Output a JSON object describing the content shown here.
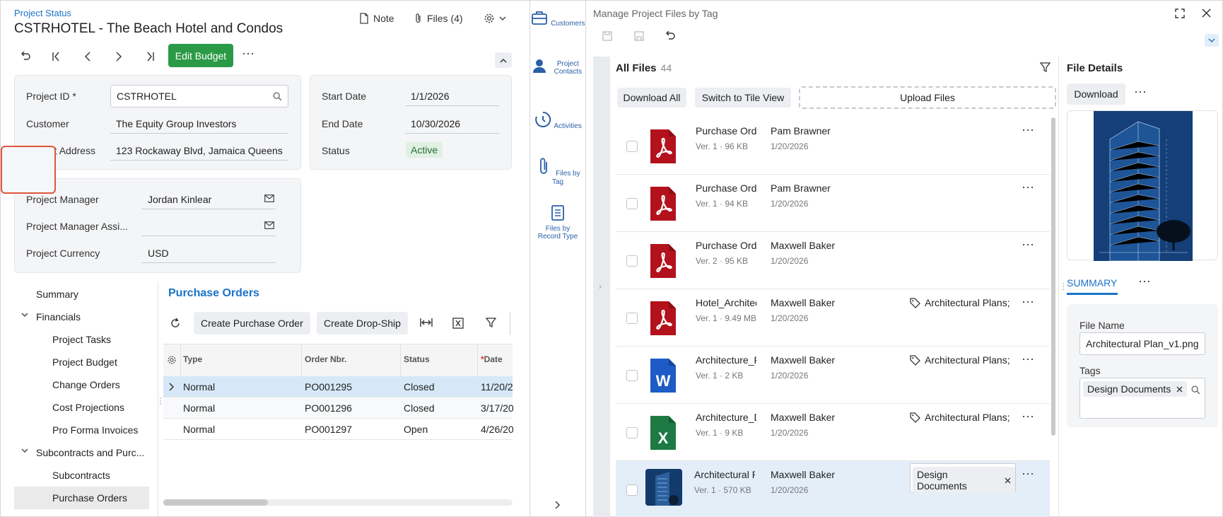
{
  "left": {
    "breadcrumb": "Project Status",
    "title": "CSTRHOTEL - The Beach Hotel and Condos",
    "note_label": "Note",
    "files_label": "Files (4)",
    "edit_budget_label": "Edit Budget",
    "summary_card": {
      "project_id_label": "Project ID *",
      "project_id_value": "CSTRHOTEL",
      "customer_label": "Customer",
      "customer_value": "The Equity Group Investors",
      "address_label": "Project Address",
      "address_value": "123 Rockaway Blvd, Jamaica Queens"
    },
    "dates_card": {
      "start_label": "Start Date",
      "start_value": "1/1/2026",
      "end_label": "End Date",
      "end_value": "10/30/2026",
      "status_label": "Status",
      "status_value": "Active"
    },
    "manager_card": {
      "pm_label": "Project Manager",
      "pm_value": "Jordan Kinlear",
      "pma_label": "Project Manager Assi...",
      "pma_value": "",
      "currency_label": "Project Currency",
      "currency_value": "USD"
    },
    "nav": {
      "summary": "Summary",
      "financials": "Financials",
      "project_tasks": "Project Tasks",
      "project_budget": "Project Budget",
      "change_orders": "Change Orders",
      "cost_projections": "Cost Projections",
      "pro_forma": "Pro Forma Invoices",
      "subcontracts_purch": "Subcontracts and Purc...",
      "subcontracts": "Subcontracts",
      "purchase_orders": "Purchase Orders"
    },
    "po": {
      "title": "Purchase Orders",
      "create_po": "Create Purchase Order",
      "create_drop_ship": "Create Drop-Ship",
      "columns": {
        "type": "Type",
        "order": "Order Nbr.",
        "status": "Status",
        "date": "Date"
      },
      "rows": [
        {
          "type": "Normal",
          "order": "PO001295",
          "status": "Closed",
          "date": "11/20/2"
        },
        {
          "type": "Normal",
          "order": "PO001296",
          "status": "Closed",
          "date": "3/17/20"
        },
        {
          "type": "Normal",
          "order": "PO001297",
          "status": "Open",
          "date": "4/26/20"
        }
      ]
    }
  },
  "rail": {
    "customers": "Customers",
    "project_contacts": "Project Contacts",
    "activities": "Activities",
    "files_by_tag": "Files by Tag",
    "files_by_record_type": "Files by Record Type"
  },
  "right": {
    "title": "Manage Project Files by Tag",
    "all_files_label": "All Files",
    "all_files_count": "44",
    "download_all": "Download All",
    "switch_tile": "Switch to Tile View",
    "upload_files": "Upload Files",
    "files": [
      {
        "name": "Purchase Order",
        "meta": "Ver. 1 · 96 KB",
        "user": "Pam Brawner",
        "date": "1/20/2026",
        "tag": "",
        "icon": "pdf-icon"
      },
      {
        "name": "Purchase Order",
        "meta": "Ver. 1 · 94 KB",
        "user": "Pam Brawner",
        "date": "1/20/2026",
        "tag": "",
        "icon": "pdf-icon"
      },
      {
        "name": "Purchase Order",
        "meta": "Ver. 2 · 95 KB",
        "user": "Maxwell Baker",
        "date": "1/20/2026",
        "tag": "",
        "icon": "pdf-icon"
      },
      {
        "name": "Hotel_Architecture",
        "meta": "Ver. 1 · 9.49 MB",
        "user": "Maxwell Baker",
        "date": "1/20/2026",
        "tag": "Architectural Plans;",
        "icon": "pdf-icon"
      },
      {
        "name": "Architecture_Plan",
        "meta": "Ver. 1 · 2 KB",
        "user": "Maxwell Baker",
        "date": "1/20/2026",
        "tag": "Architectural Plans;",
        "icon": "word-icon"
      },
      {
        "name": "Architecture_Data",
        "meta": "Ver. 1 · 9 KB",
        "user": "Maxwell Baker",
        "date": "1/20/2026",
        "tag": "Architectural Plans;",
        "icon": "excel-icon"
      },
      {
        "name": "Architectural Plan",
        "meta": "Ver. 1 · 570 KB",
        "user": "Maxwell Baker",
        "date": "1/20/2026",
        "tag": "Design Documents",
        "icon": "image-thumbnail"
      }
    ],
    "details": {
      "title": "File Details",
      "download": "Download",
      "summary_tab": "SUMMARY",
      "file_name_label": "File Name",
      "file_name_value": "Architectural Plan_v1.png",
      "tags_label": "Tags",
      "tag_chip": "Design Documents"
    }
  },
  "colors": {
    "accent": "#1a73c8",
    "green": "#2b9a46",
    "pdf_red": "#b3121c",
    "word_blue": "#1e5bc6",
    "excel_green": "#1d7a43",
    "rail_active_border": "#e0563b"
  }
}
